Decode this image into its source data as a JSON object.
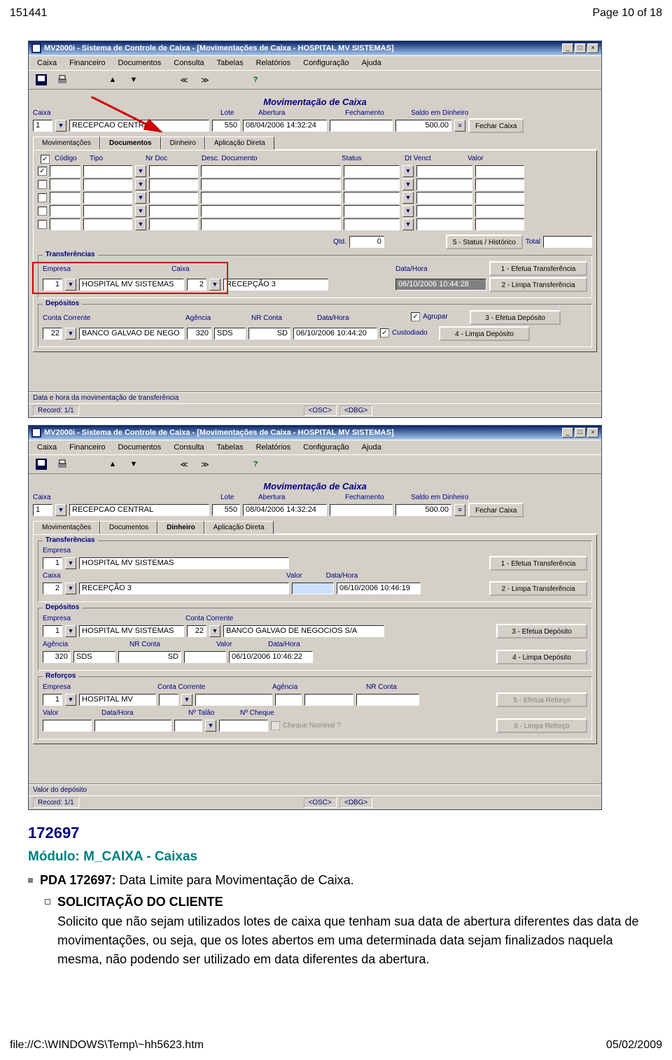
{
  "page_header_left": "151441",
  "page_header_right": "Page 10 of 18",
  "app": {
    "title": "MV2000i - Sistema de Controle de Caixa - [Movimentações de Caixa - HOSPITAL MV SISTEMAS]",
    "menu": [
      "Caixa",
      "Financeiro",
      "Documentos",
      "Consulta",
      "Tabelas",
      "Relatórios",
      "Configuração",
      "Ajuda"
    ],
    "section_title": "Movimentação de Caixa",
    "labels": {
      "caixa": "Caixa",
      "lote": "Lote",
      "abertura": "Abertura",
      "fechamento": "Fechamento",
      "saldo": "Saldo em Dinheiro",
      "fechar": "Fechar Caixa"
    },
    "header": {
      "caixa_num": "1",
      "caixa_nome": "RECEPCAO CENTRAL",
      "lote": "550",
      "abertura": "08/04/2006 14:32:24",
      "fechamento": "",
      "saldo": "500.00"
    },
    "tabs": [
      "Movimentações",
      "Documentos",
      "Dinheiro",
      "Aplicação Direta"
    ],
    "documentos": {
      "cols": [
        "Código",
        "Tipo",
        "Nr Doc",
        "Desc. Documento",
        "Status",
        "Dt Venct",
        "Valor"
      ],
      "qtd_label": "Qtd.",
      "qtd_val": "0",
      "status_btn": "5 - Status / Histórico",
      "total_label": "Total"
    },
    "transferencias": {
      "title": "Transferências",
      "empresa_lbl": "Empresa",
      "empresa_num": "1",
      "empresa_nome": "HOSPITAL MV SISTEMAS",
      "caixa_lbl": "Caixa",
      "caixa_num": "2",
      "caixa_nome": "RECEPÇÃO 3",
      "datahora_lbl": "Data/Hora",
      "datahora": "06/10/2006 10:44:28",
      "btn1": "1 - Efetua Transferência",
      "btn2": "2 - Limpa Transferência"
    },
    "depositos": {
      "title": "Depósitos",
      "conta_lbl": "Conta Corrente",
      "conta_num": "22",
      "conta_nome": "BANCO GALVAO DE NEGO",
      "agencia_lbl": "Agência",
      "agencia": "320",
      "agencia2": "SDS",
      "nrconta_lbl": "NR Conta",
      "nrconta": "SD",
      "datahora_lbl": "Data/Hora",
      "datahora": "06/10/2006 10:44:20",
      "agrupar": "Agrupar",
      "custodiado": "Custodiado",
      "btn3": "3 - Efetua Depósito",
      "btn4": "4 - Limpa Depósito"
    },
    "status1": "Data e hora da movimentação de transferência",
    "status_record": "Record: 1/1",
    "status_osc": "<OSC>",
    "status_dbg": "<DBG>"
  },
  "app2": {
    "transferencias": {
      "empresa_num": "1",
      "empresa_nome": "HOSPITAL MV SISTEMAS",
      "caixa_num": "2",
      "caixa_nome": "RECEPÇÃO 3",
      "valor_lbl": "Valor",
      "datahora_lbl": "Data/Hora",
      "datahora": "06/10/2006 10:46:19"
    },
    "depositos": {
      "empresa_num": "1",
      "empresa_nome": "HOSPITAL MV SISTEMAS",
      "conta_num": "22",
      "conta_nome": "BANCO GALVAO DE NEGOCIOS S/A",
      "agencia": "320",
      "agencia2": "SDS",
      "nrconta": "SD",
      "datahora": "06/10/2006 10:46:22"
    },
    "reforcos": {
      "title": "Reforços",
      "empresa_lbl": "Empresa",
      "empresa_num": "1",
      "empresa_nome": "HOSPITAL MV SISTE",
      "conta_lbl": "Conta Corrente",
      "agencia_lbl": "Agência",
      "nrconta_lbl": "NR Conta",
      "valor_lbl": "Valor",
      "datahora_lbl": "Data/Hora",
      "talao_lbl": "Nº Talão",
      "cheque_lbl": "Nº Cheque",
      "nominal_lbl": "Cheque Nominal ?",
      "btn5": "5 - Efetua Reforço",
      "btn6": "6 - Limpa Reforço"
    },
    "status1": "Valor do depósito"
  },
  "article": {
    "id": "172697",
    "module": "Módulo: M_CAIXA  -  Caixas",
    "pda": "PDA 172697:",
    "pda_title": "Data Limite para Movimentação de Caixa.",
    "solicit_title": "SOLICITAÇÃO DO CLIENTE",
    "solicit_body": "Solicito que não sejam utilizados lotes de caixa que tenham sua data de abertura diferentes das data de movimentações, ou seja, que os lotes abertos em uma determinada data sejam finalizados naquela mesma, não podendo ser utilizado em data diferentes da abertura."
  },
  "footer_left": "file://C:\\WINDOWS\\Temp\\~hh5623.htm",
  "footer_right": "05/02/2009"
}
